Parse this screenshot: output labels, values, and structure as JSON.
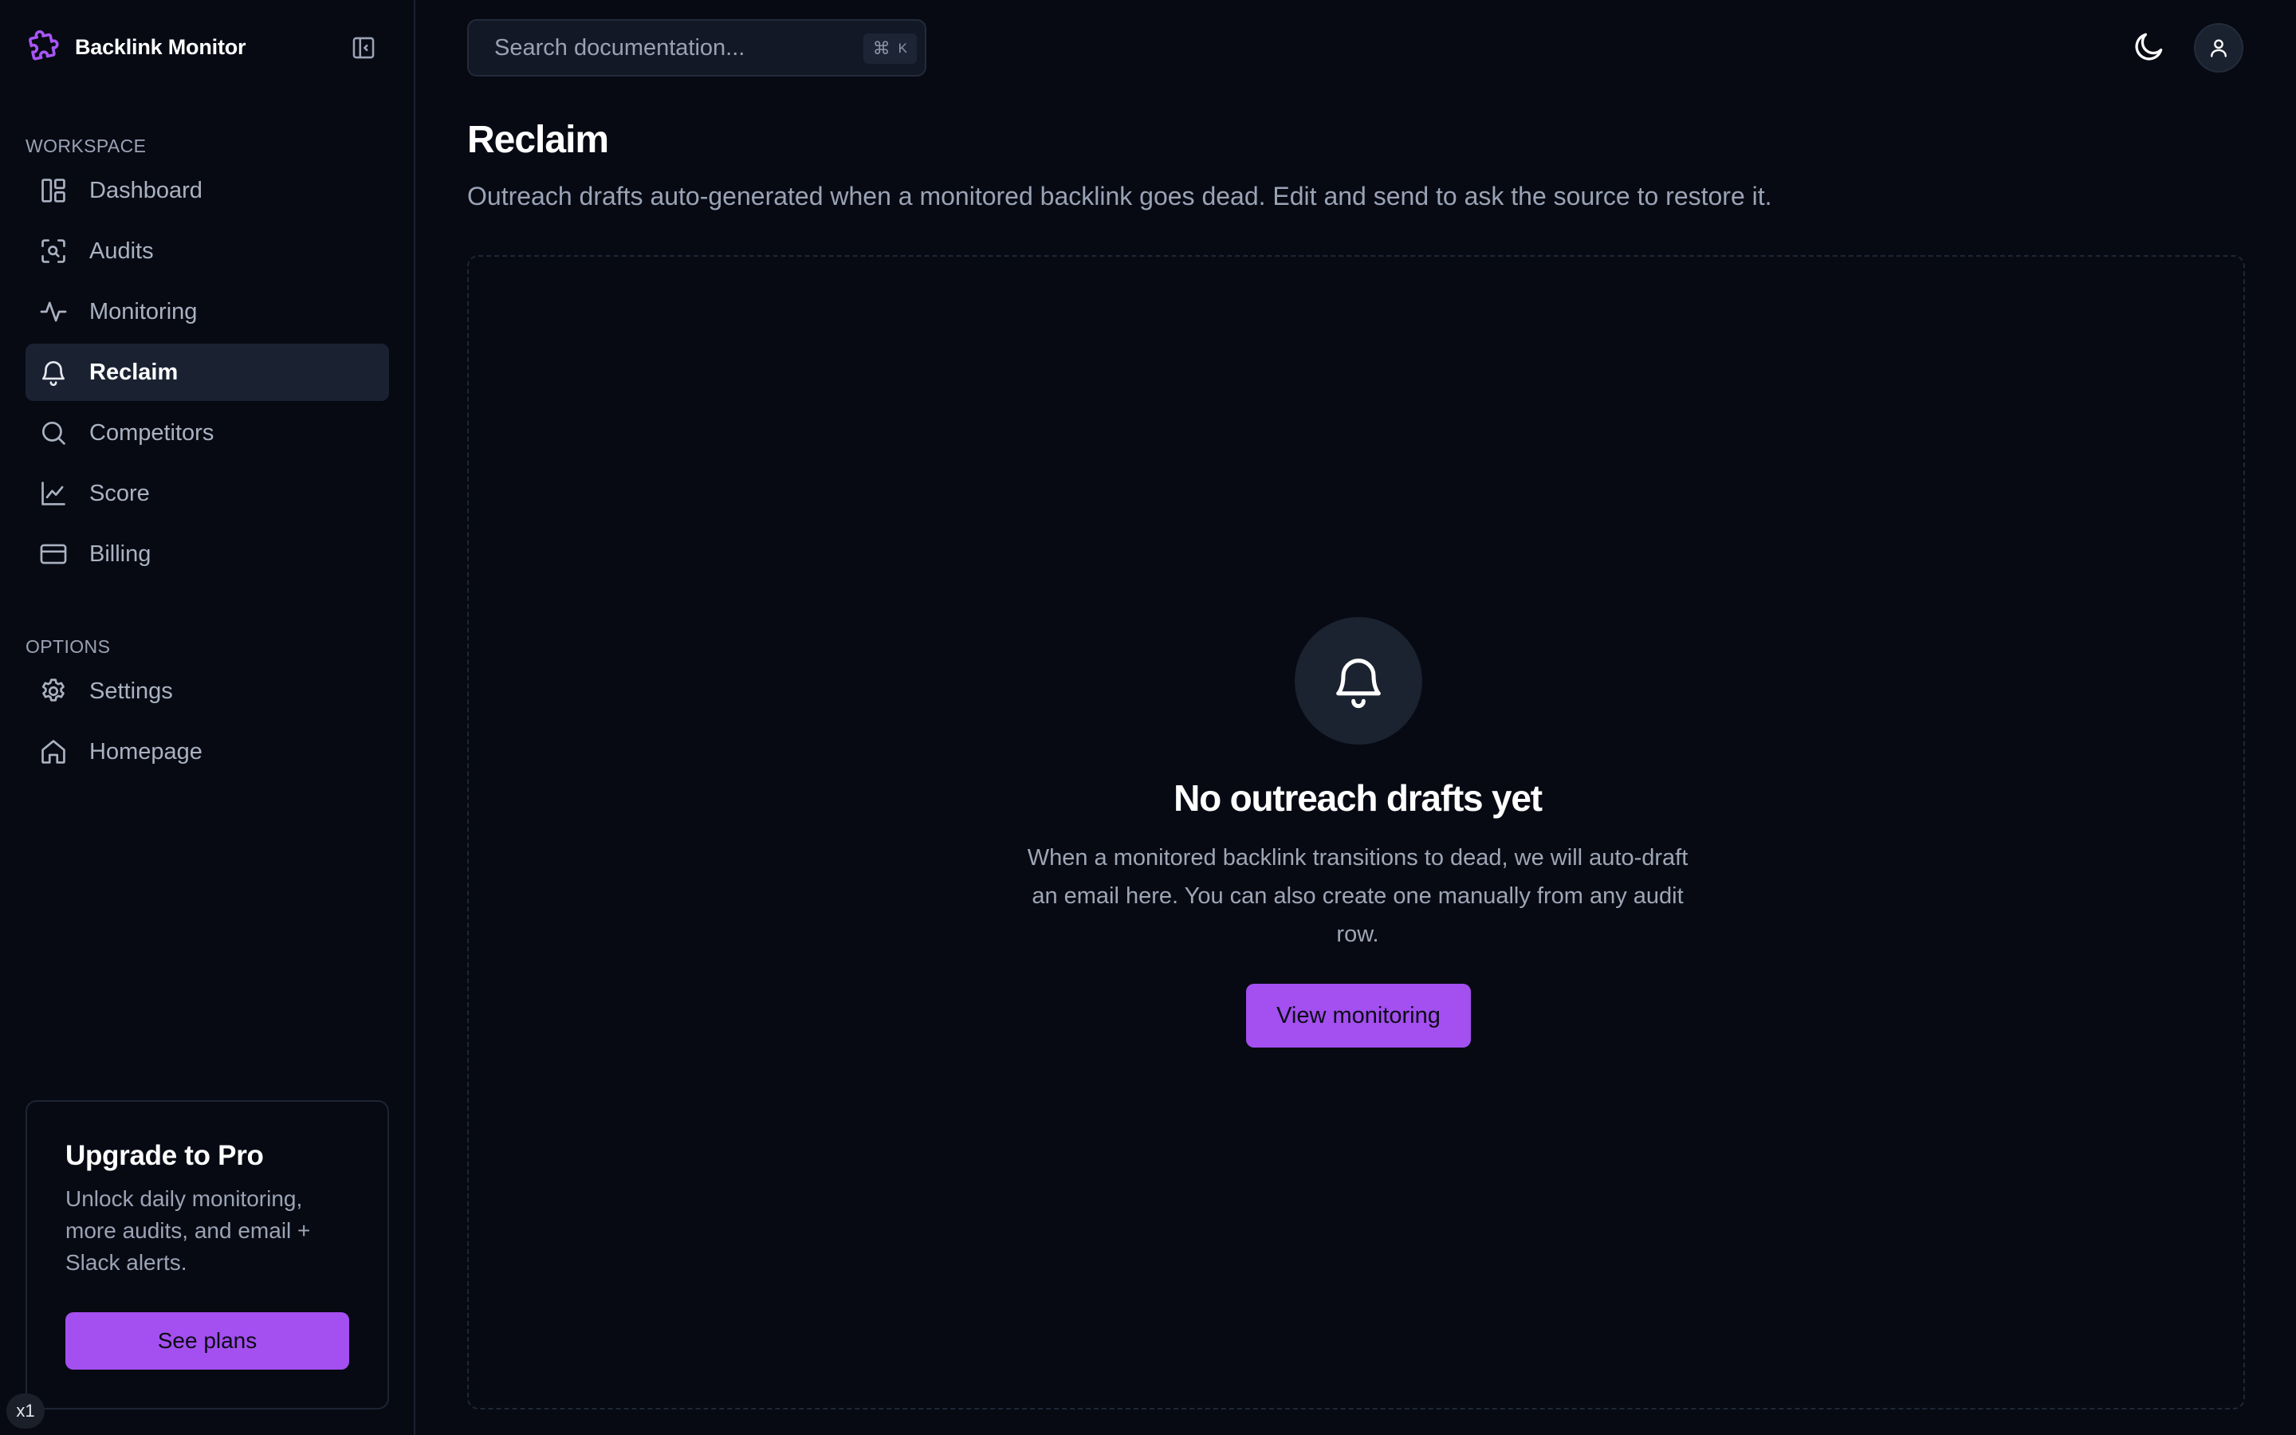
{
  "app": {
    "name": "Backlink Monitor"
  },
  "sidebar": {
    "workspace_label": "WORKSPACE",
    "workspace_items": [
      {
        "label": "Dashboard",
        "icon": "dashboard-icon"
      },
      {
        "label": "Audits",
        "icon": "audit-scan-icon"
      },
      {
        "label": "Monitoring",
        "icon": "activity-icon"
      },
      {
        "label": "Reclaim",
        "icon": "bell-icon",
        "active": true
      },
      {
        "label": "Competitors",
        "icon": "search-icon"
      },
      {
        "label": "Score",
        "icon": "line-chart-icon"
      },
      {
        "label": "Billing",
        "icon": "credit-card-icon"
      }
    ],
    "options_label": "OPTIONS",
    "options_items": [
      {
        "label": "Settings",
        "icon": "gear-icon"
      },
      {
        "label": "Homepage",
        "icon": "home-icon"
      }
    ],
    "upgrade": {
      "title": "Upgrade to Pro",
      "description": "Unlock daily monitoring, more audits, and email + Slack alerts.",
      "button_label": "See plans"
    }
  },
  "topbar": {
    "search_placeholder": "Search documentation...",
    "shortcut_symbol": "⌘",
    "shortcut_key": "K"
  },
  "main": {
    "title": "Reclaim",
    "subtitle": "Outreach drafts auto-generated when a monitored backlink goes dead. Edit and send to ask the source to restore it.",
    "empty_state": {
      "icon": "bell-icon",
      "title": "No outreach drafts yet",
      "description": "When a monitored backlink transitions to dead, we will auto-draft an email here. You can also create one manually from any audit row.",
      "button_label": "View monitoring"
    }
  },
  "zoom_badge": "x1",
  "colors": {
    "background": "#070a13",
    "accent": "#a44ff0",
    "active_nav": "#1a2232",
    "muted_text": "#9aa3b5"
  }
}
